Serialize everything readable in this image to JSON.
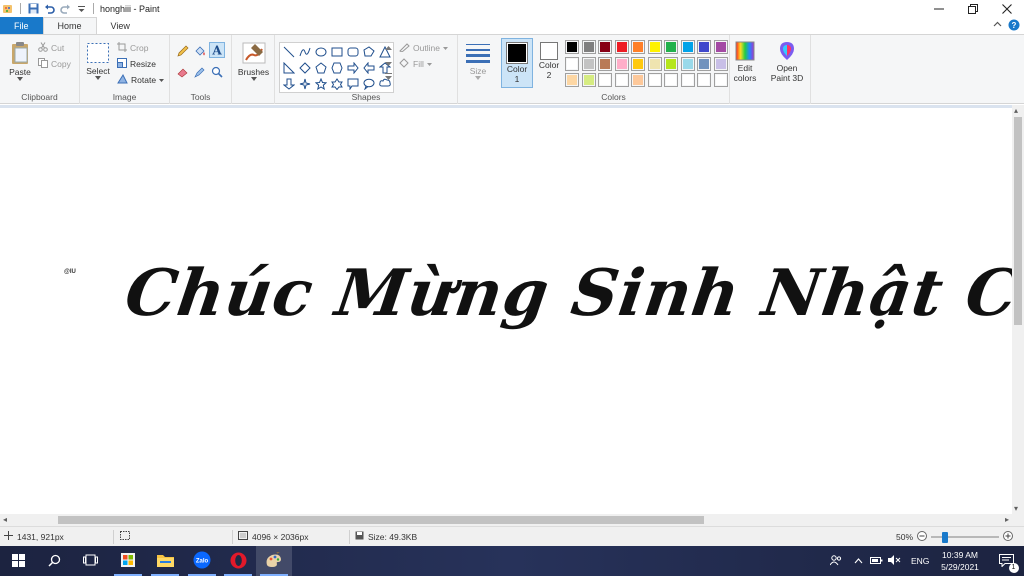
{
  "window": {
    "title": "honghiii - Paint"
  },
  "tabs": [
    {
      "label": "File"
    },
    {
      "label": "Home"
    },
    {
      "label": "View"
    }
  ],
  "ribbon": {
    "clipboard": {
      "label": "Clipboard",
      "paste": "Paste",
      "cut": "Cut",
      "copy": "Copy"
    },
    "image": {
      "label": "Image",
      "select": "Select",
      "crop": "Crop",
      "resize": "Resize",
      "rotate": "Rotate"
    },
    "tools": {
      "label": "Tools"
    },
    "brushes": {
      "label": "Brushes"
    },
    "shapes": {
      "label": "Shapes",
      "outline": "Outline",
      "fill": "Fill"
    },
    "size": {
      "label": "Size"
    },
    "color1": {
      "label": "Color",
      "number": "1",
      "color": "#000000"
    },
    "color2": {
      "label": "Color",
      "number": "2",
      "color": "#ffffff"
    },
    "colors": {
      "label": "Colors",
      "palette_row1": [
        "#000000",
        "#7f7f7f",
        "#880015",
        "#ed1c24",
        "#ff7f27",
        "#fff200",
        "#22b14c",
        "#00a2e8",
        "#3f48cc",
        "#a349a4"
      ],
      "palette_row2": [
        "#ffffff",
        "#c3c3c3",
        "#b97a57",
        "#ffaec9",
        "#ffc90e",
        "#efe4b0",
        "#b5e61d",
        "#99d9ea",
        "#7092be",
        "#c8bfe7"
      ],
      "palette_row3": [
        "#fdd7a4",
        "#d6ec82",
        "#ffffff",
        "#ffffff",
        "#fdc89a",
        "#ffffff",
        "#ffffff",
        "#ffffff",
        "#ffffff",
        "#ffffff"
      ]
    },
    "edit_colors": {
      "line1": "Edit",
      "line2": "colors"
    },
    "paint3d": {
      "line1": "Open",
      "line2": "Paint 3D"
    }
  },
  "canvas": {
    "text": "Chúc Mừng Sinh Nhật Cây",
    "watermark": "@IU"
  },
  "status": {
    "cursor_pos": "1431, 921px",
    "image_size": "4096 × 2036px",
    "file_size": "Size: 49.3KB",
    "zoom": "50%",
    "zoom_fraction": 0.18
  },
  "taskbar": {
    "language": "ENG",
    "time": "10:39 AM",
    "date": "5/29/2021",
    "notification_count": "1"
  }
}
